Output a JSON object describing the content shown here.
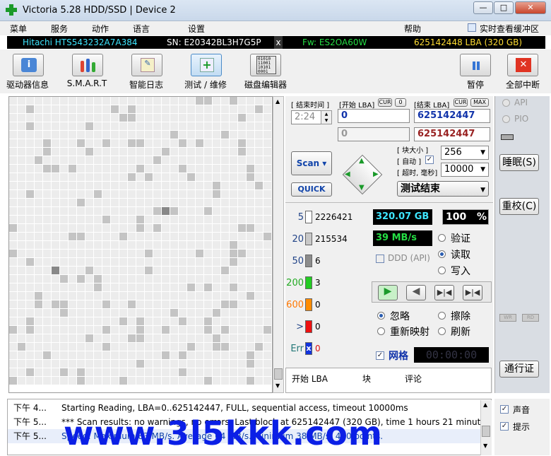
{
  "window": {
    "title": "Victoria 5.28 HDD/SSD | Device 2",
    "min": "—",
    "max": "□",
    "close": "✕"
  },
  "menu": {
    "items": [
      "菜单",
      "服务",
      "动作",
      "语言",
      "设置",
      "帮助"
    ],
    "cache_label": "实时查看缓冲区"
  },
  "info": {
    "model": "Hitachi HTS543232A7A384",
    "serial": "SN: E20342BL3H7G5P",
    "close": "x",
    "firmware": "Fw: ES2OA60W",
    "lba": "625142448 LBA (320 GB)"
  },
  "toolbar": {
    "drive_info": "驱动器信息",
    "smart": "S.M.A.R.T",
    "log": "智能日志",
    "test": "测试 / 维修",
    "editor": "磁盘编辑器",
    "pause": "暂停",
    "abort": "全部中断"
  },
  "scan": {
    "end_time_label": "[ 结束时间 ]",
    "start_lba_label": "[开始 LBA]",
    "cur": "CUR",
    "zero": "0",
    "end_lba_label": "[结束 LBA]",
    "max": "MAX",
    "time": "2:24",
    "start_lba": "0",
    "end_lba": "625142447",
    "start_lba2": "0",
    "end_lba2": "625142447",
    "block_size_label": "[ 块大小 ]",
    "auto_label": "[ 自动 ]",
    "timeout_label": "[ 超时, 毫秒]",
    "block_size": "256",
    "timeout": "10000",
    "scan_btn": "Scan",
    "quick_btn": "QUICK",
    "status": "测试结束"
  },
  "legend": [
    {
      "label": "5",
      "count": "2226421",
      "color": "#ffffff",
      "text_color": "#224488"
    },
    {
      "label": "20",
      "count": "215534",
      "color": "#c8c8c8",
      "text_color": "#224488"
    },
    {
      "label": "50",
      "count": "6",
      "color": "#8c8c8c",
      "text_color": "#224488"
    },
    {
      "label": "200",
      "count": "3",
      "color": "#22cc22",
      "text_color": "#22aa22"
    },
    {
      "label": "600",
      "count": "0",
      "color": "#ff8c00",
      "text_color": "#ff7700"
    },
    {
      "label": ">",
      "count": "0",
      "color": "#ee1111",
      "text_color": "#224488"
    },
    {
      "label": "Err",
      "count": "0",
      "color": "#1133dd",
      "text_color": "#227777",
      "mark": "x"
    }
  ],
  "stats": {
    "size": "320.07 GB",
    "percent": "100",
    "pct": "%",
    "speed": "39 MB/s",
    "ddd": "DDD (API)",
    "verify": "验证",
    "read": "读取",
    "write": "写入"
  },
  "actions": {
    "ignore": "忽略",
    "erase": "擦除",
    "remap": "重新映射",
    "refresh": "刷新",
    "grid": "网格",
    "timer": "00:00:00"
  },
  "table": {
    "col1": "开始 LBA",
    "col2": "块",
    "col3": "评论"
  },
  "right": {
    "api": "API",
    "pio": "PIO",
    "sleep": "睡眠(S)",
    "recal": "重校(C)",
    "wr": "WR",
    "rd": "RD",
    "passport": "通行证"
  },
  "log": [
    {
      "time": "下午 4...",
      "msg": "Starting Reading, LBA=0..625142447, FULL, sequential access, timeout 10000ms"
    },
    {
      "time": "下午 5...",
      "msg": "*** Scan results: no warnings, no errors. Last block at 625142447 (320 GB), time 1 hours 21 minut..."
    },
    {
      "time": "下午 5...",
      "msg": "Speed: Maximum 83 MB/s. Average 64 MB/s. Minimum 38 MB/s. 420 points."
    }
  ],
  "bottom": {
    "sound": "声音",
    "hint": "提示"
  },
  "watermark": "www.3l5kkk.com"
}
